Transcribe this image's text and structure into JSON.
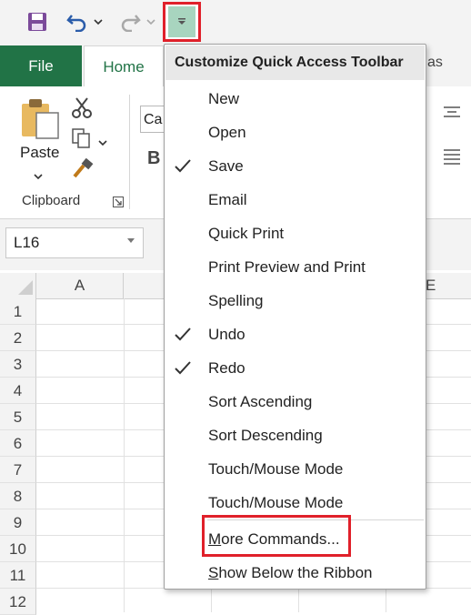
{
  "ribbon": {
    "tab_file": "File",
    "tab_home": "Home",
    "tab_partial": "as",
    "paste_label": "Paste",
    "clipboard_label": "Clipboard",
    "font_box_value": "Ca",
    "bold_label": "B"
  },
  "namebox": {
    "value": "L16"
  },
  "columns": [
    "A",
    "E"
  ],
  "rows": [
    "1",
    "2",
    "3",
    "4",
    "5",
    "6",
    "7",
    "8",
    "9",
    "10",
    "11",
    "12"
  ],
  "menu": {
    "title": "Customize Quick Access Toolbar",
    "items": [
      {
        "label": "New",
        "checked": false
      },
      {
        "label": "Open",
        "checked": false
      },
      {
        "label": "Save",
        "checked": true
      },
      {
        "label": "Email",
        "checked": false
      },
      {
        "label": "Quick Print",
        "checked": false
      },
      {
        "label": "Print Preview and Print",
        "checked": false
      },
      {
        "label": "Spelling",
        "checked": false
      },
      {
        "label": "Undo",
        "checked": true
      },
      {
        "label": "Redo",
        "checked": true
      },
      {
        "label": "Sort Ascending",
        "checked": false
      },
      {
        "label": "Sort Descending",
        "checked": false
      },
      {
        "label": "Touch/Mouse Mode",
        "checked": false
      },
      {
        "label": "Touch/Mouse Mode",
        "checked": false
      }
    ],
    "more_commands": {
      "hotkey": "M",
      "rest": "ore Commands..."
    },
    "show_below": {
      "hotkey": "S",
      "rest": "how Below the Ribbon"
    }
  },
  "colors": {
    "file_tab": "#217346",
    "highlight_box": "#e0202a",
    "customize_button": "#a8d5bf"
  }
}
